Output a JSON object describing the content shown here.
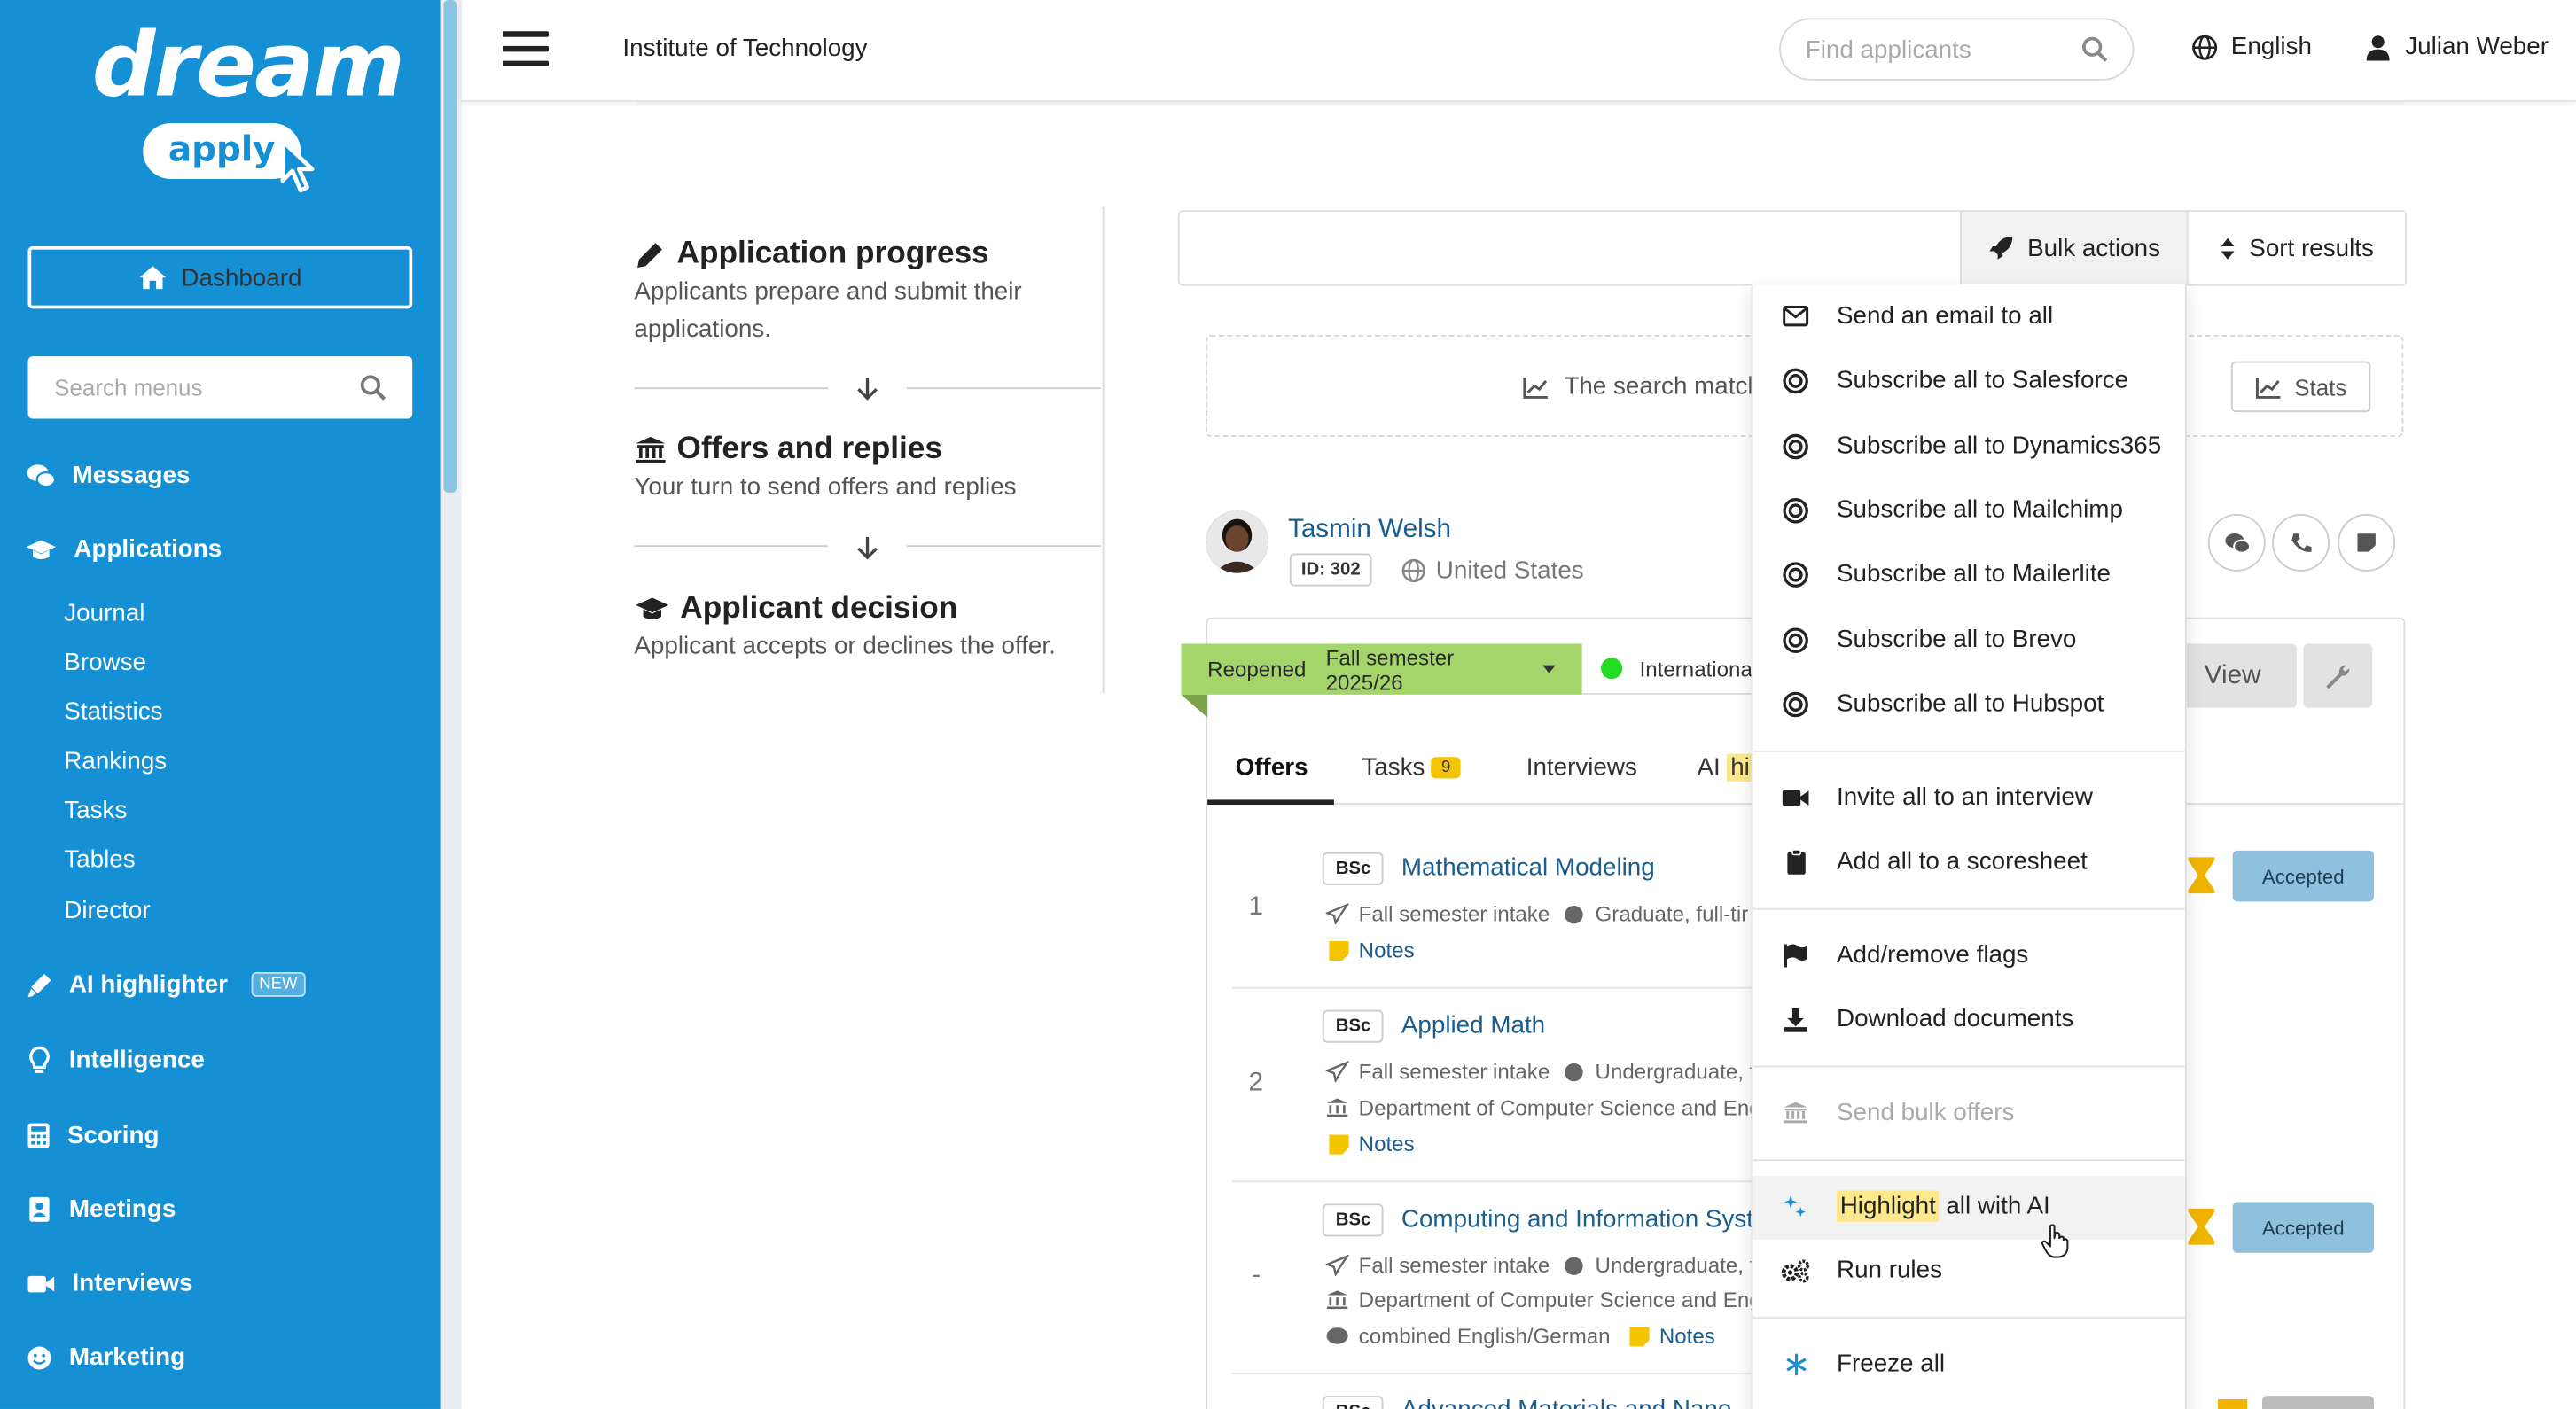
{
  "brand": {
    "logo_top": "dream",
    "logo_bottom": "apply"
  },
  "sidebar": {
    "dashboard_label": "Dashboard",
    "search_placeholder": "Search menus",
    "items": [
      {
        "label": "Messages",
        "icon": "comments-icon"
      },
      {
        "label": "Applications",
        "icon": "graduation-cap-icon"
      },
      {
        "label": "AI highlighter",
        "icon": "highlighter-icon",
        "badge": "NEW"
      },
      {
        "label": "Intelligence",
        "icon": "lightbulb-icon"
      },
      {
        "label": "Scoring",
        "icon": "calculator-icon"
      },
      {
        "label": "Meetings",
        "icon": "address-book-icon"
      },
      {
        "label": "Interviews",
        "icon": "video-icon"
      },
      {
        "label": "Marketing",
        "icon": "smile-icon"
      }
    ],
    "application_subitems": [
      "Journal",
      "Browse",
      "Statistics",
      "Rankings",
      "Tasks",
      "Tables",
      "Director"
    ]
  },
  "topbar": {
    "institution": "Institute of Technology",
    "find_placeholder": "Find applicants",
    "language": "English",
    "user": "Julian Weber"
  },
  "progress": {
    "steps": [
      {
        "title": "Application progress",
        "desc_line1": "Applicants prepare and submit their",
        "desc_line2": "applications."
      },
      {
        "title": "Offers and replies",
        "desc_line1": "Your turn to send offers and replies"
      },
      {
        "title": "Applicant decision",
        "desc_line1": "Applicant accepts or declines the offer."
      }
    ]
  },
  "toolbar": {
    "bulk_actions": "Bulk actions",
    "sort_results": "Sort results"
  },
  "search_info": {
    "text": "The search match",
    "stats_button": "Stats"
  },
  "applicant": {
    "name": "Tasmin Welsh",
    "id": "ID: 302",
    "country": "United States",
    "status": "Reopened",
    "intake": "Fall semester 2025/26",
    "tag": "International",
    "view_button": "View",
    "tabs": [
      {
        "label": "Offers"
      },
      {
        "label": "Tasks",
        "badge": "9"
      },
      {
        "label": "Interviews"
      },
      {
        "label": "AI",
        "highlight": "hi"
      }
    ],
    "offers": [
      {
        "num": "1",
        "degree": "BSc",
        "program": "Mathematical Modeling",
        "intake": "Fall semester intake",
        "level": "Graduate, full-tir",
        "notes": "Notes",
        "status": "Accepted"
      },
      {
        "num": "2",
        "degree": "BSc",
        "program": "Applied Math",
        "intake": "Fall semester intake",
        "level": "Undergraduate, f",
        "dept": "Department of Computer Science and Eng",
        "notes": "Notes"
      },
      {
        "num": "-",
        "degree": "BSc",
        "program": "Computing and Information Syst",
        "intake": "Fall semester intake",
        "level": "Undergraduate, f",
        "dept": "Department of Computer Science and Eng",
        "lang": "combined English/German",
        "notes": "Notes",
        "status": "Accepted"
      },
      {
        "num": "",
        "degree": "BSc",
        "program": "Advanced Materials and Nano"
      }
    ]
  },
  "bulk_menu": {
    "items": [
      {
        "label": "Send an email to all",
        "icon": "envelope-icon"
      },
      {
        "label": "Subscribe all to Salesforce",
        "icon": "bullseye-icon"
      },
      {
        "label": "Subscribe all to Dynamics365",
        "icon": "bullseye-icon"
      },
      {
        "label": "Subscribe all to Mailchimp",
        "icon": "bullseye-icon"
      },
      {
        "label": "Subscribe all to Mailerlite",
        "icon": "bullseye-icon"
      },
      {
        "label": "Subscribe all to Brevo",
        "icon": "bullseye-icon"
      },
      {
        "label": "Subscribe all to Hubspot",
        "icon": "bullseye-icon"
      },
      {
        "label": "Invite all to an interview",
        "icon": "video-icon"
      },
      {
        "label": "Add all to a scoresheet",
        "icon": "clipboard-icon"
      },
      {
        "label": "Add/remove flags",
        "icon": "flag-icon"
      },
      {
        "label": "Download documents",
        "icon": "download-icon"
      },
      {
        "label": "Send bulk offers",
        "icon": "university-icon",
        "disabled": true
      },
      {
        "label_highlight": "Highlight",
        "label_rest": "all with AI",
        "icon": "sparkles-icon"
      },
      {
        "label": "Run rules",
        "icon": "cogs-icon"
      },
      {
        "label": "Freeze all",
        "icon": "snowflake-icon"
      }
    ]
  },
  "colors": {
    "brand_blue": "#1590d4",
    "reopened_green": "#a4d56a",
    "accepted_blue": "#8fc0dd",
    "highlight_yellow": "#fde98c",
    "status_green": "#2ecc40",
    "hourglass": "#f0b400"
  }
}
